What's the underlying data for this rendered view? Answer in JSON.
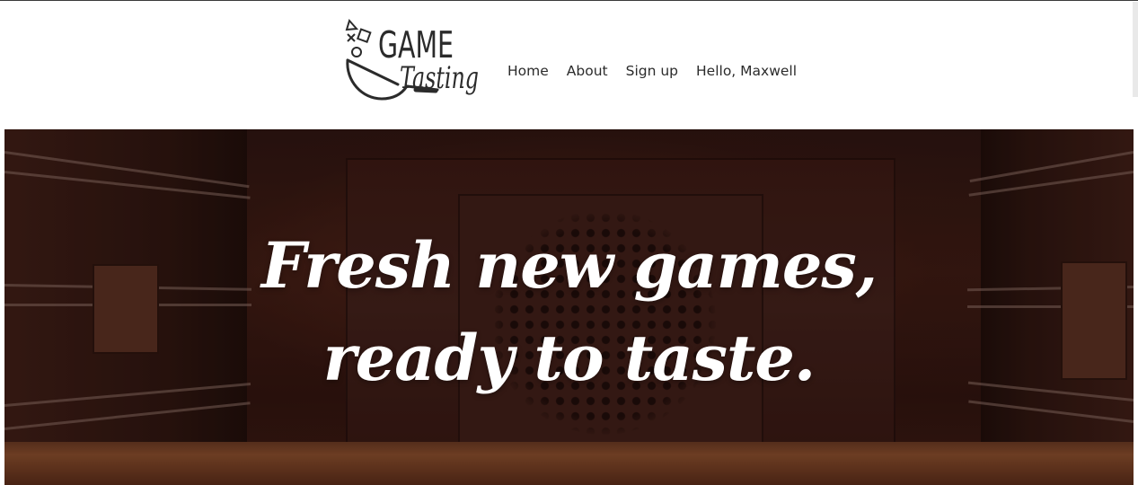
{
  "brand": {
    "logo_word_top": "GAME",
    "logo_word_bottom": "Tasting",
    "icon": "pan-with-game-buttons-icon"
  },
  "nav": {
    "items": [
      {
        "label": "Home"
      },
      {
        "label": "About"
      },
      {
        "label": "Sign up"
      },
      {
        "label": "Hello, Maxwell"
      }
    ]
  },
  "hero": {
    "line1": "Fresh new games,",
    "line2": "ready to taste."
  },
  "colors": {
    "text": "#2b2b2b",
    "hero_text": "#ffffff",
    "hero_bg": "#3b1b13"
  }
}
